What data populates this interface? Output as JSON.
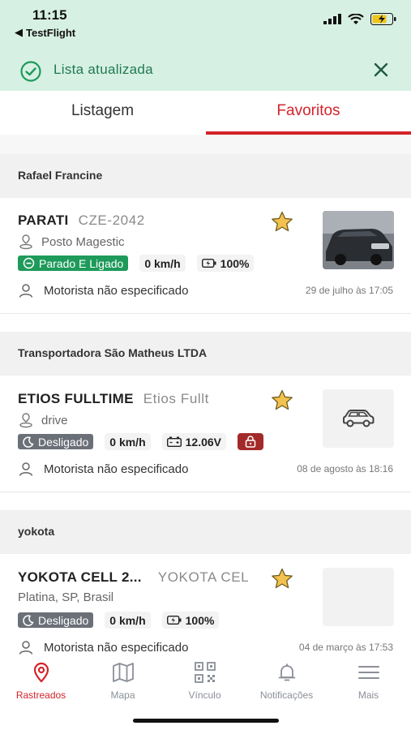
{
  "status_bar": {
    "time": "11:15",
    "back_app": "TestFlight"
  },
  "toast": {
    "message": "Lista atualizada"
  },
  "tabs": [
    {
      "label": "Listagem"
    },
    {
      "label": "Favoritos"
    }
  ],
  "groups": [
    {
      "name": "Rafael Francine",
      "vehicle": {
        "name": "PARATI",
        "plate": "CZE-2042",
        "location": "Posto Magestic",
        "status": "Parado E Ligado",
        "speed": "0 km/h",
        "battery": "100%",
        "driver": "Motorista não especificado",
        "date": "29 de julho às 17:05"
      }
    },
    {
      "name": "Transportadora São Matheus LTDA",
      "vehicle": {
        "name": "ETIOS FULLTIME",
        "plate": "Etios Fullt",
        "location": "drive",
        "status": "Desligado",
        "speed": "0 km/h",
        "voltage": "12.06V",
        "driver": "Motorista não especificado",
        "date": "08 de agosto às 18:16"
      }
    },
    {
      "name": "yokota",
      "vehicle": {
        "name": "YOKOTA CELL 2...",
        "plate": "YOKOTA CEL",
        "location": "Platina, SP, Brasil",
        "status": "Desligado",
        "speed": "0 km/h",
        "battery": "100%",
        "driver": "Motorista não especificado",
        "date": "04 de março às 17:53"
      }
    }
  ],
  "bottom_nav": [
    {
      "label": "Rastreados",
      "icon": "location-pin-icon",
      "active": true
    },
    {
      "label": "Mapa",
      "icon": "map-icon"
    },
    {
      "label": "Vínculo",
      "icon": "qr-code-icon"
    },
    {
      "label": "Notificações",
      "icon": "bell-icon"
    },
    {
      "label": "Mais",
      "icon": "menu-icon"
    }
  ],
  "colors": {
    "accent": "#d3232a",
    "success": "#1e9a5a",
    "toast_bg": "#d7f0e4",
    "star": "#f2c14e",
    "lock": "#a32a2a"
  }
}
